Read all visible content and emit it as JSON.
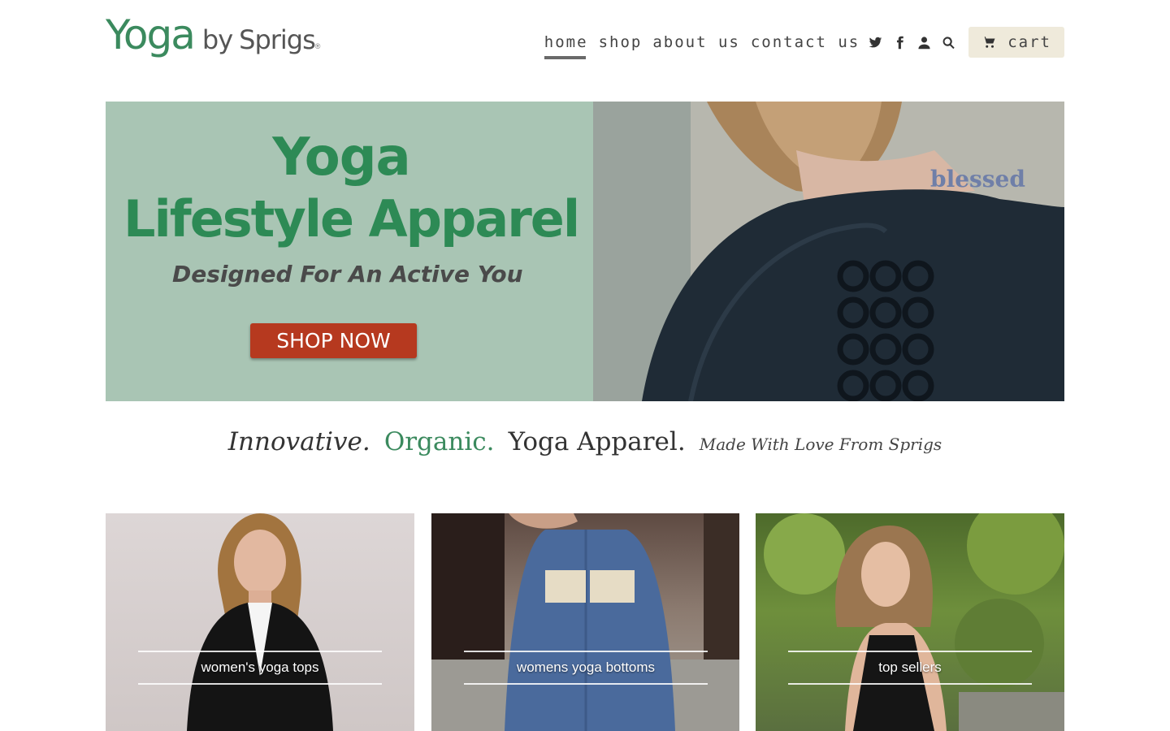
{
  "logo": {
    "main": "Yoga",
    "by": "by",
    "brand": "Sprigs",
    "reg": "®"
  },
  "nav": {
    "links": [
      "home",
      "shop",
      "about us",
      "contact us"
    ],
    "active": "home",
    "icons": [
      "twitter-icon",
      "facebook-icon",
      "account-icon",
      "search-icon"
    ],
    "cart_label": "cart",
    "cart_icon": "cart-icon"
  },
  "hero": {
    "title_line1": "Yoga",
    "title_line2": "Lifestyle Apparel",
    "subtitle": "Designed For An Active You",
    "cta": "SHOP NOW",
    "tattoo_text": "blessed"
  },
  "tagline": {
    "part1": "Innovative.",
    "part2": "Organic.",
    "part3": "Yoga Apparel.",
    "part4": "Made With Love From Sprigs"
  },
  "collections": [
    {
      "label": "women's yoga tops"
    },
    {
      "label": "womens yoga bottoms"
    },
    {
      "label": "top sellers"
    }
  ],
  "colors": {
    "brand_green": "#3b8a5e",
    "cta_red": "#b6391f",
    "hero_bg": "#a9c5b4",
    "cart_bg": "#efeadb"
  }
}
